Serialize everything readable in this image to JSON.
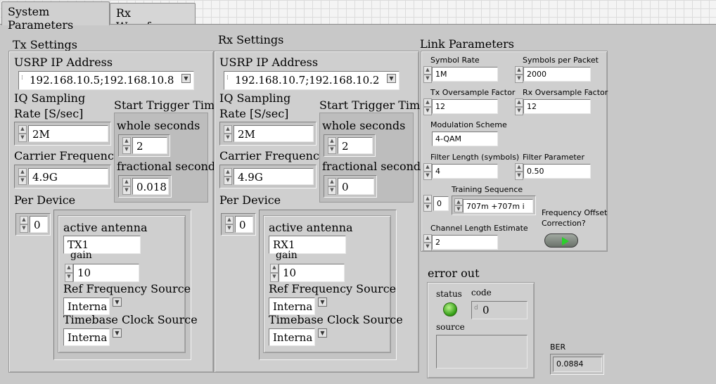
{
  "tabs": [
    {
      "label": "System Parameters",
      "active": true
    },
    {
      "label": "Rx Waveforms",
      "active": false
    }
  ],
  "tx": {
    "title": "Tx Settings",
    "usrp_ip_label": "USRP IP Address",
    "usrp_ip_value": "192.168.10.5;192.168.10.8",
    "iq_rate_label_1": "IQ Sampling",
    "iq_rate_label_2": "Rate [S/sec]",
    "iq_rate_value": "2M",
    "start_trigger_label": "Start Trigger Time",
    "whole_seconds_label": "whole seconds",
    "whole_seconds_value": "2",
    "fractional_seconds_label": "fractional seconds",
    "fractional_seconds_value": "0.018",
    "carrier_freq_label": "Carrier Frequency [H",
    "carrier_freq_value": "4.9G",
    "per_device_label": "Per Device",
    "per_device_index": "0",
    "active_antenna_label": "active antenna",
    "active_antenna_value": "TX1",
    "gain_label": "gain",
    "gain_value": "10",
    "ref_freq_label": "Ref Frequency Source",
    "ref_freq_value": "Interna",
    "timebase_label": "Timebase Clock Source",
    "timebase_value": "Interna"
  },
  "rx": {
    "title": "Rx Settings",
    "usrp_ip_label": "USRP IP Address",
    "usrp_ip_value": "192.168.10.7;192.168.10.2",
    "iq_rate_label_1": "IQ Sampling",
    "iq_rate_label_2": "Rate [S/sec]",
    "iq_rate_value": "2M",
    "start_trigger_label": "Start Trigger Time",
    "whole_seconds_label": "whole seconds",
    "whole_seconds_value": "2",
    "fractional_seconds_label": "fractional seconds",
    "fractional_seconds_value": "0",
    "carrier_freq_label": "Carrier Frequency [H",
    "carrier_freq_value": "4.9G",
    "per_device_label": "Per Device",
    "per_device_index": "0",
    "active_antenna_label": "active antenna",
    "active_antenna_value": "RX1",
    "gain_label": "gain",
    "gain_value": "10",
    "ref_freq_label": "Ref Frequency Source",
    "ref_freq_value": "Interna",
    "timebase_label": "Timebase Clock Source",
    "timebase_value": "Interna"
  },
  "link": {
    "title": "Link Parameters",
    "symbol_rate_label": "Symbol Rate",
    "symbol_rate_value": "1M",
    "symbols_per_packet_label": "Symbols per Packet",
    "symbols_per_packet_value": "2000",
    "tx_oversample_label": "Tx Oversample Factor",
    "tx_oversample_value": "12",
    "rx_oversample_label": "Rx Oversample Factor",
    "rx_oversample_value": "12",
    "modulation_label": "Modulation Scheme",
    "modulation_value": "4-QAM",
    "filter_length_label": "Filter Length (symbols)",
    "filter_length_value": "4",
    "filter_param_label": "Filter Parameter",
    "filter_param_value": "0.50",
    "training_index": "0",
    "training_label": "Training Sequence",
    "training_value": "707m +707m i",
    "freq_offset_label_1": "Frequency Offset",
    "freq_offset_label_2": "Correction?",
    "freq_offset_state": true,
    "channel_length_label": "Channel Length Estimate",
    "channel_length_value": "2"
  },
  "error_out": {
    "title": "error out",
    "status_label": "status",
    "code_label": "code",
    "code_value": "0",
    "source_label": "source",
    "source_value": "",
    "status_color": "#2f9a12"
  },
  "ber": {
    "label": "BER",
    "value": "0.0884"
  }
}
